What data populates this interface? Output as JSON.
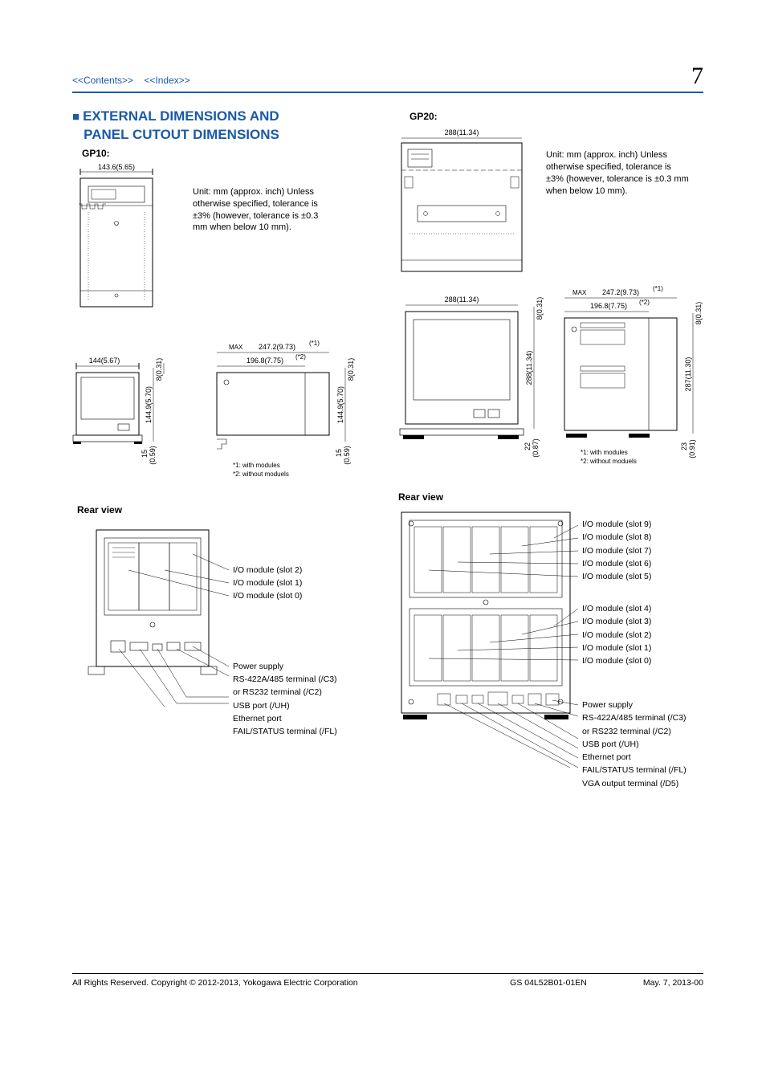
{
  "nav": {
    "contents": "<<Contents>>",
    "index": "<<Index>>"
  },
  "page_number": "7",
  "section_title_line1": "EXTERNAL DIMENSIONS AND",
  "section_title_line2": "PANEL CUTOUT DIMENSIONS",
  "models": {
    "gp10": "GP10:",
    "gp20": "GP20:"
  },
  "unit_note": "Unit: mm (approx. inch) Unless otherwise specified, tolerance is ±3% (however, tolerance is ±0.3 mm when below 10 mm).",
  "rear_view": "Rear view",
  "gp10": {
    "front_w": "143.6(5.65)",
    "side_w": "144(5.67)",
    "side_h": "144.9(5.70)",
    "proj_top": "8(0.31)",
    "proj_bot1": "15",
    "proj_bot2": "(0.59)",
    "depth_max": "247.2(9.73)",
    "depth_max_pre": "MAX",
    "depth_max_suf": "(*1)",
    "depth_nom": "196.8(7.75)",
    "depth_nom_suf": "(*2)",
    "depth_h": "144.9(5.70)",
    "depth_proj_top": "8(0.31)",
    "depth_bot1": "15",
    "depth_bot2": "(0.59)",
    "foot1": "*1: with modules",
    "foot2": "*2: without moduels"
  },
  "gp20": {
    "top_w": "288(11.34)",
    "side_w": "288(11.34)",
    "side_h": "288(11.34)",
    "proj_top": "8(0.31)",
    "proj_bot1": "22",
    "proj_bot2": "(0.87)",
    "depth_max": "247.2(9.73)",
    "depth_max_pre": "MAX",
    "depth_max_suf": "(*1)",
    "depth_nom": "196.8(7.75)",
    "depth_nom_suf": "(*2)",
    "depth_h": "287(11.30)",
    "depth_proj_top": "8(0.31)",
    "depth_bot1": "23",
    "depth_bot2": "(0.91)",
    "foot1": "*1: with modules",
    "foot2": "*2: without moduels"
  },
  "gp10_rear": {
    "c0": "I/O module (slot 2)",
    "c1": "I/O module (slot 1)",
    "c2": "I/O module (slot 0)",
    "c3": "Power supply",
    "c4": "RS-422A/485 terminal (/C3)",
    "c5": "or RS232 terminal (/C2)",
    "c6": "USB port (/UH)",
    "c7": "Ethernet port",
    "c8": "FAIL/STATUS terminal (/FL)"
  },
  "gp20_rear": {
    "a0": "I/O module (slot 9)",
    "a1": "I/O module (slot 8)",
    "a2": "I/O module (slot 7)",
    "a3": "I/O module (slot 6)",
    "a4": "I/O module (slot 5)",
    "b0": "I/O module (slot 4)",
    "b1": "I/O module (slot 3)",
    "b2": "I/O module (slot 2)",
    "b3": "I/O module (slot 1)",
    "b4": "I/O module (slot 0)",
    "c0": "Power supply",
    "c1": "RS-422A/485 terminal (/C3)",
    "c2": "or RS232 terminal (/C2)",
    "c3": "USB port (/UH)",
    "c4": "Ethernet port",
    "c5": "FAIL/STATUS terminal (/FL)",
    "c6": "VGA output terminal (/D5)"
  },
  "footer": {
    "copyright": "All Rights Reserved. Copyright © 2012-2013, Yokogawa Electric Corporation",
    "docnum": "GS 04L52B01-01EN",
    "date": "May. 7, 2013-00"
  }
}
